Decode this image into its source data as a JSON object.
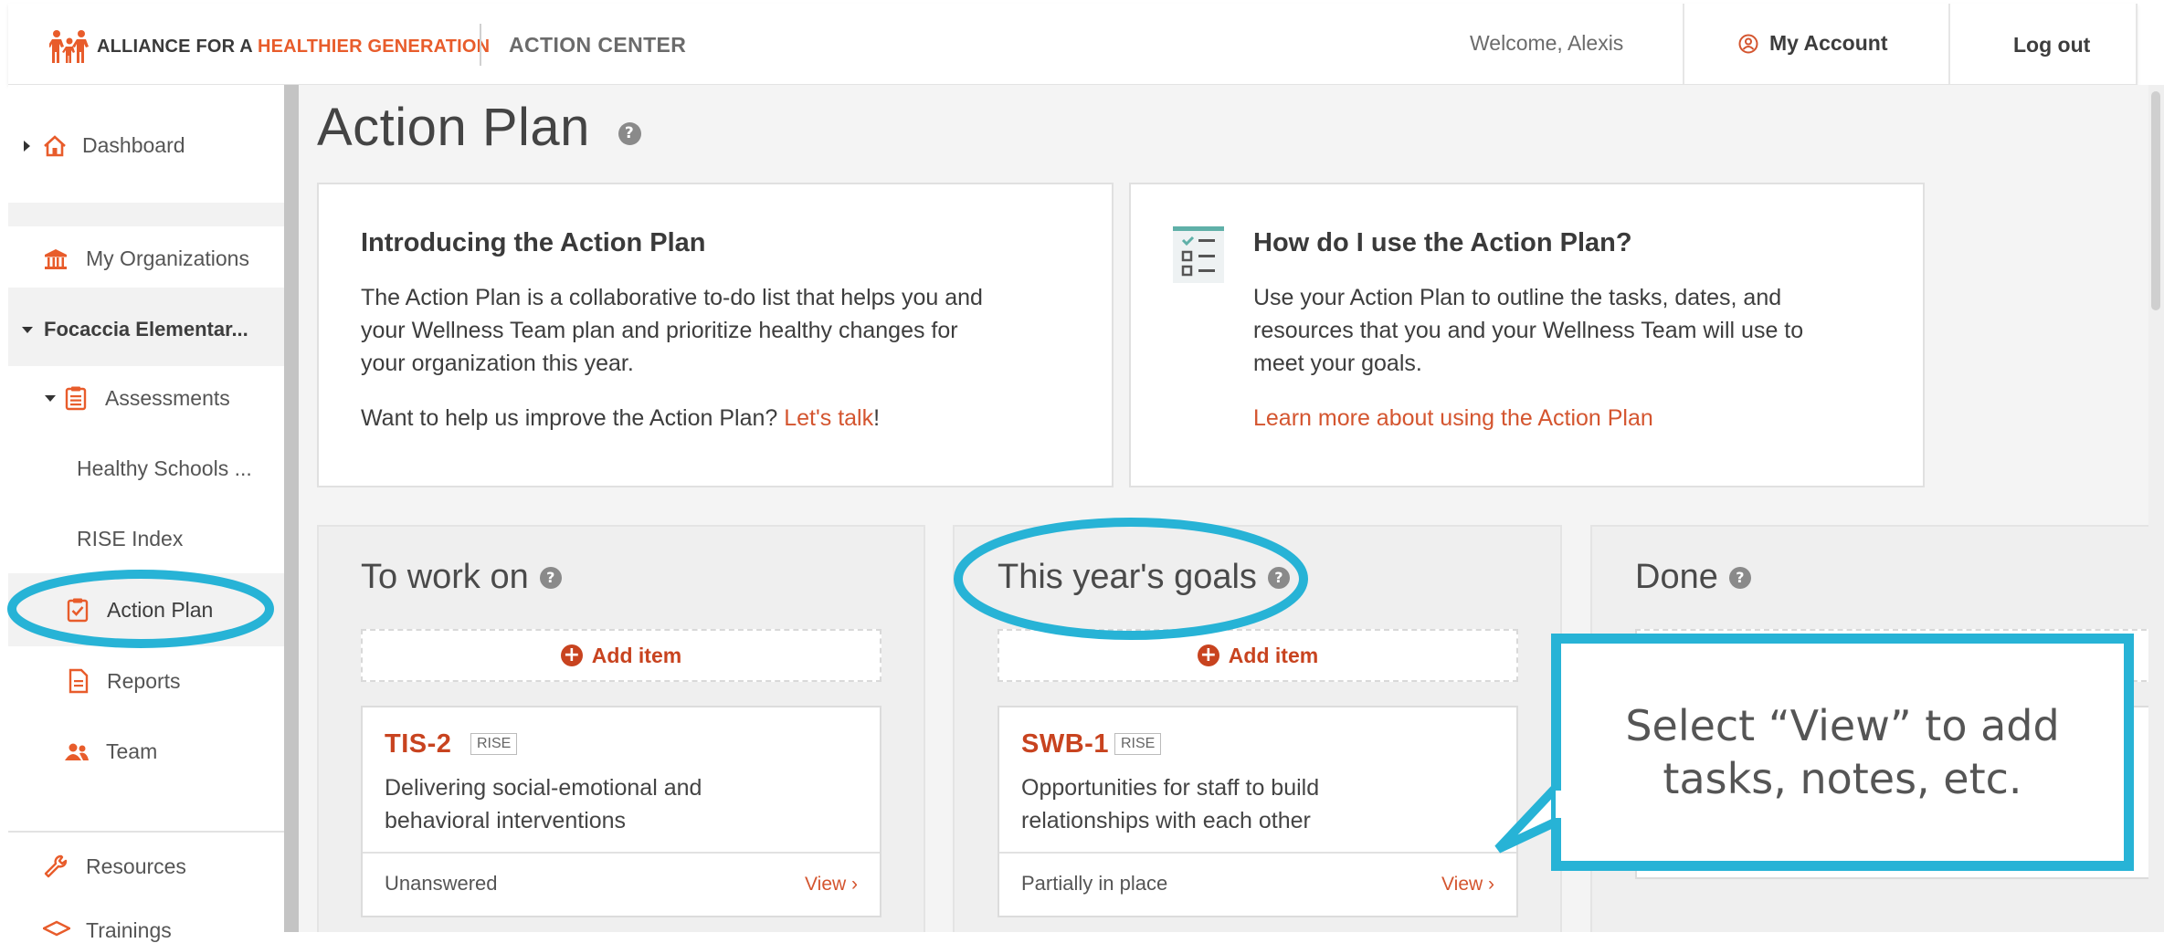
{
  "header": {
    "brand_prefix": "ALLIANCE FOR A ",
    "brand_accent": "HEALTHIER GENERATION",
    "section": "ACTION CENTER",
    "welcome": "Welcome, Alexis",
    "account_label": "My Account",
    "logout_label": "Log out"
  },
  "sidebar": {
    "dashboard": "Dashboard",
    "my_organizations": "My Organizations",
    "organization": "Focaccia Elementar...",
    "assessments": "Assessments",
    "healthy_schools": "Healthy Schools ...",
    "rise_index": "RISE Index",
    "action_plan": "Action Plan",
    "reports": "Reports",
    "team": "Team",
    "resources": "Resources",
    "trainings": "Trainings"
  },
  "page": {
    "title": "Action Plan",
    "help_glyph": "?"
  },
  "intro_card": {
    "heading": "Introducing the Action Plan",
    "body_line1": "The Action Plan is a collaborative to-do list that helps you and",
    "body_line2": "your Wellness Team plan and prioritize healthy changes for",
    "body_line3": "your organization this year.",
    "feedback_prefix": "Want to help us improve the Action Plan? ",
    "feedback_link": "Let's talk",
    "feedback_suffix": "!"
  },
  "howto_card": {
    "heading": "How do I use the Action Plan?",
    "body_line1": "Use your Action Plan to outline the tasks, dates, and",
    "body_line2": "resources that you and your Wellness Team will use to",
    "body_line3": "meet your goals.",
    "link": "Learn more about using the Action Plan"
  },
  "columns": {
    "to_work_on": {
      "title": "To work on",
      "add_label": "Add item",
      "card": {
        "code": "TIS-2",
        "tag": "RISE",
        "desc_line1": "Delivering social-emotional and",
        "desc_line2": "behavioral interventions",
        "status": "Unanswered",
        "view": "View ›"
      }
    },
    "goals": {
      "title": "This year's goals",
      "add_label": "Add item",
      "card": {
        "code": "SWB-1",
        "tag": "RISE",
        "desc_line1": "Opportunities for staff to build",
        "desc_line2": "relationships with each other",
        "status": "Partially in place",
        "view": "View ›"
      }
    },
    "done": {
      "title": "Done"
    }
  },
  "overlay": {
    "callout_line1": "Select “View” to add",
    "callout_line2": "tasks, notes, etc."
  },
  "colors": {
    "accent": "#d4552f",
    "brand_orange": "#e85c2b",
    "highlight": "#27b3d6"
  }
}
